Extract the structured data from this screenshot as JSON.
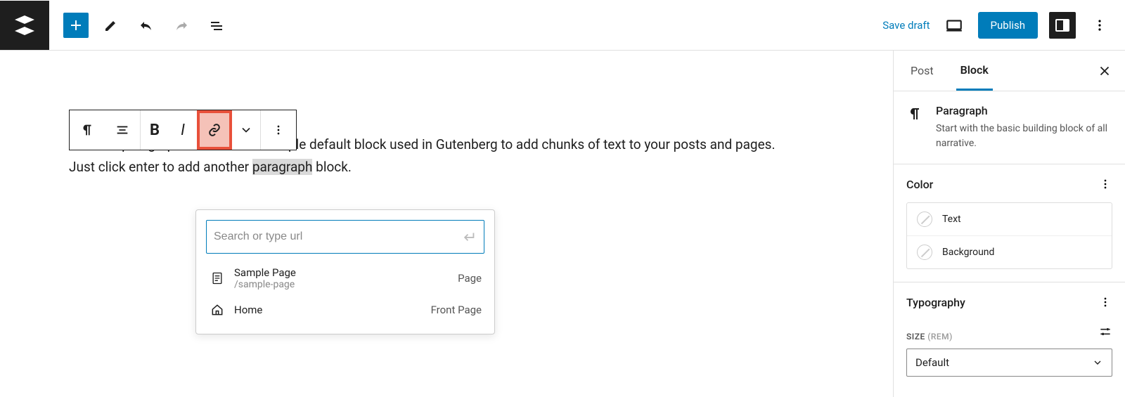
{
  "toolbar": {
    "save_draft": "Save draft",
    "publish": "Publish"
  },
  "editor": {
    "paragraph_text_before": "This is a paragraph block. It's the simple default block used in Gutenberg to add chunks of text to your posts and pages. Just click enter to add another ",
    "paragraph_highlight": "paragraph",
    "paragraph_text_after": " block."
  },
  "link_popover": {
    "placeholder": "Search or type url",
    "suggestions": [
      {
        "title": "Sample Page",
        "path": "/sample-page",
        "type": "Page"
      },
      {
        "title": "Home",
        "path": "",
        "type": "Front Page"
      }
    ]
  },
  "sidebar": {
    "tabs": {
      "post": "Post",
      "block": "Block"
    },
    "block_info": {
      "title": "Paragraph",
      "desc": "Start with the basic building block of all narrative."
    },
    "color": {
      "label": "Color",
      "text": "Text",
      "background": "Background"
    },
    "typography": {
      "label": "Typography",
      "size_label": "SIZE",
      "size_unit": "(REM)",
      "size_value": "Default"
    }
  }
}
